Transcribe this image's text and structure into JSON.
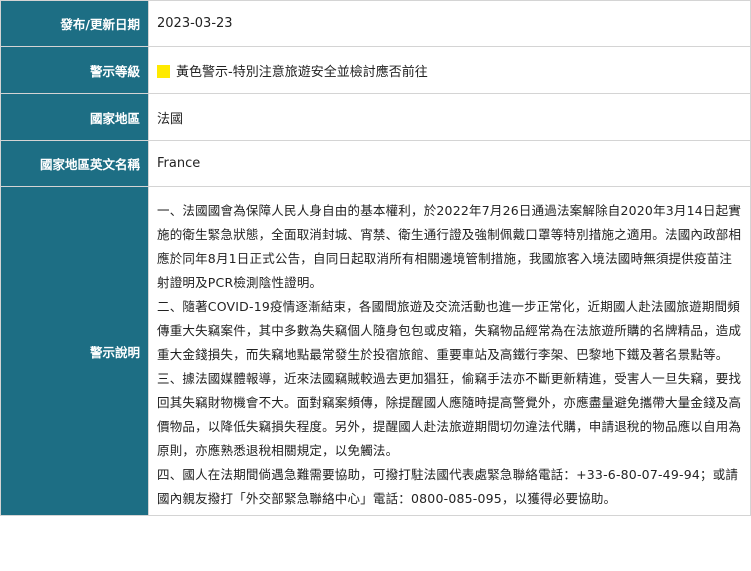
{
  "rows": {
    "date": {
      "label": "發布/更新日期",
      "value": "2023-03-23"
    },
    "level": {
      "label": "警示等級",
      "value": "黃色警示-特別注意旅遊安全並檢討應否前往",
      "color": "#ffea00"
    },
    "country": {
      "label": "國家地區",
      "value": "法國"
    },
    "country_en": {
      "label": "國家地區英文名稱",
      "value": "France"
    },
    "description": {
      "label": "警示說明",
      "paragraphs": [
        "一、法國國會為保障人民人身自由的基本權利，於2022年7月26日通過法案解除自2020年3月14日起實施的衛生緊急狀態，全面取消封城、宵禁、衛生通行證及強制佩戴口罩等特別措施之適用。法國內政部相應於同年8月1日正式公告，自同日起取消所有相關邊境管制措施，我國旅客入境法國時無須提供疫苗注射證明及PCR檢測陰性證明。",
        "二、隨著COVID-19疫情逐漸結束，各國間旅遊及交流活動也進一步正常化，近期國人赴法國旅遊期間頻傳重大失竊案件，其中多數為失竊個人隨身包包或皮箱，失竊物品經常為在法旅遊所購的名牌精品，造成重大金錢損失，而失竊地點最常發生於投宿旅館、重要車站及高鐵行李架、巴黎地下鐵及著名景點等。",
        "三、據法國媒體報導，近來法國竊賊較過去更加猖狂，偷竊手法亦不斷更新精進，受害人一旦失竊，要找回其失竊財物機會不大。面對竊案頻傳，除提醒國人應隨時提高警覺外，亦應盡量避免攜帶大量金錢及高價物品，以降低失竊損失程度。另外，提醒國人赴法旅遊期間切勿違法代購，申請退稅的物品應以自用為原則，亦應熟悉退稅相關規定，以免觸法。",
        "四、國人在法期間倘遇急難需要協助，可撥打駐法國代表處緊急聯絡電話：+33-6-80-07-49-94；或請國內親友撥打「外交部緊急聯絡中心」電話：0800-085-095，以獲得必要協助。"
      ]
    }
  }
}
